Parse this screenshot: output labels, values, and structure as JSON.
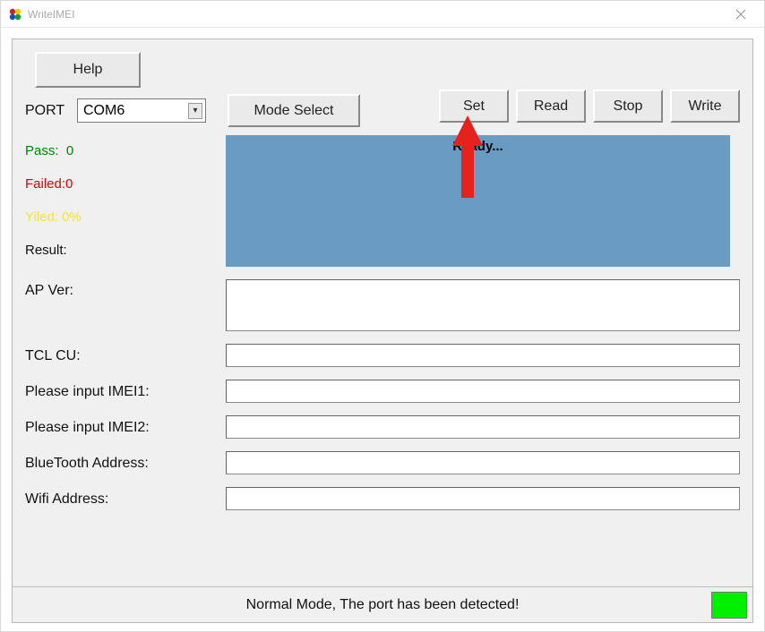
{
  "window": {
    "title": "WriteIMEI"
  },
  "toolbar": {
    "help_label": "Help",
    "port_label": "PORT",
    "port_value": "COM6",
    "mode_select_label": "Mode Select",
    "set_label": "Set",
    "read_label": "Read",
    "stop_label": "Stop",
    "write_label": "Write"
  },
  "stats": {
    "pass_label": "Pass:",
    "pass_value": "0",
    "failed_label": "Failed:",
    "failed_value": "0",
    "yiled_label": "Yiled:",
    "yiled_value": "0%",
    "result_label": "Result:"
  },
  "log": {
    "text": "Ready..."
  },
  "fields": {
    "ap_ver_label": "AP Ver:",
    "ap_ver_value": "",
    "tcl_cu_label": "TCL CU:",
    "tcl_cu_value": "",
    "imei1_label": "Please input IMEI1:",
    "imei1_value": "",
    "imei2_label": "Please input IMEI2:",
    "imei2_value": "",
    "bluetooth_label": "BlueTooth Address:",
    "bluetooth_value": "",
    "wifi_label": "Wifi Address:",
    "wifi_value": ""
  },
  "status": {
    "text": "Normal Mode, The port has been detected!",
    "indicator_color": "#00f000"
  },
  "accent_arrow_color": "#e6221f"
}
